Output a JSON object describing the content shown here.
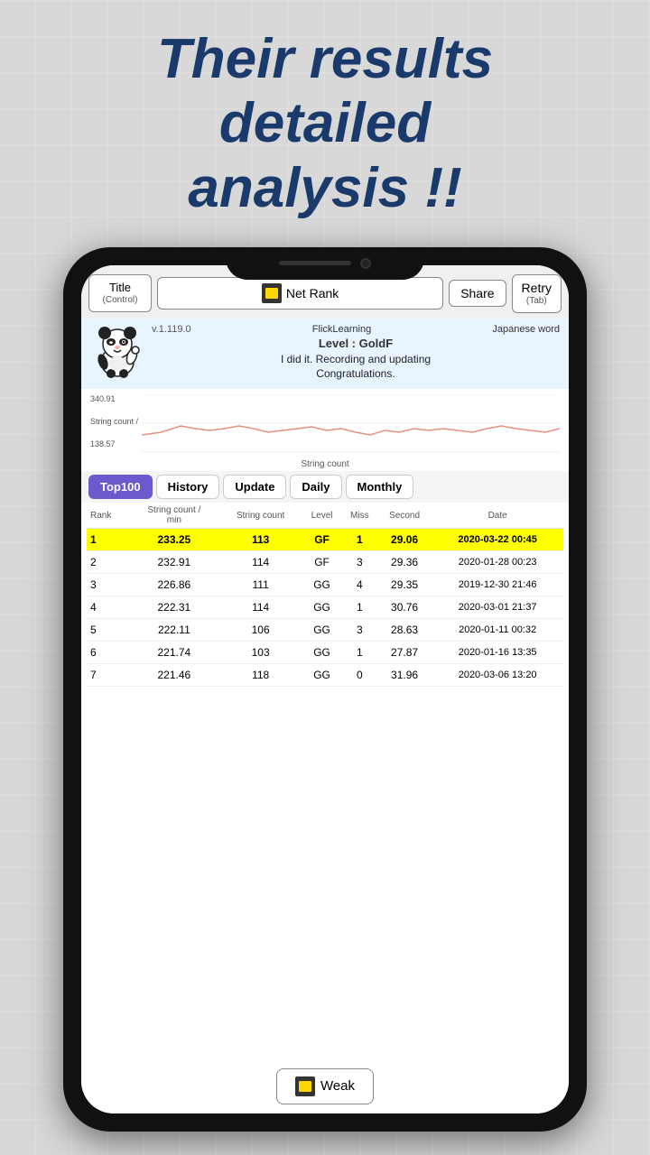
{
  "headline": {
    "line1": "Their results",
    "line2": "detailed",
    "line3": "analysis !!"
  },
  "toolbar": {
    "title_label": "Title",
    "title_sub": "(Control)",
    "netrank_label": "Net Rank",
    "share_label": "Share",
    "retry_label": "Retry",
    "retry_sub": "(Tab)"
  },
  "info": {
    "version": "v.1.119.0",
    "app_name": "FlickLearning",
    "subject": "Japanese word",
    "level": "Level : GoldF",
    "message": "I did it. Recording and updating\nCongratulations."
  },
  "chart": {
    "y_top": "340.91",
    "y_label": "String count /",
    "y_bot": "138.57",
    "x_label": "String count"
  },
  "tabs": [
    {
      "label": "Top100",
      "active": true
    },
    {
      "label": "History",
      "active": false
    },
    {
      "label": "Update",
      "active": false
    },
    {
      "label": "Daily",
      "active": false
    },
    {
      "label": "Monthly",
      "active": false
    }
  ],
  "table": {
    "headers": [
      "Rank",
      "String count /\nmin",
      "String count",
      "Level",
      "Miss",
      "Second",
      "Date"
    ],
    "rows": [
      {
        "rank": "1",
        "str_per_min": "233.25",
        "str_count": "113",
        "level": "GF",
        "miss": "1",
        "second": "29.06",
        "date": "2020-03-22 00:45",
        "highlight": true
      },
      {
        "rank": "2",
        "str_per_min": "232.91",
        "str_count": "114",
        "level": "GF",
        "miss": "3",
        "second": "29.36",
        "date": "2020-01-28 00:23",
        "highlight": false
      },
      {
        "rank": "3",
        "str_per_min": "226.86",
        "str_count": "111",
        "level": "GG",
        "miss": "4",
        "second": "29.35",
        "date": "2019-12-30 21:46",
        "highlight": false
      },
      {
        "rank": "4",
        "str_per_min": "222.31",
        "str_count": "114",
        "level": "GG",
        "miss": "1",
        "second": "30.76",
        "date": "2020-03-01 21:37",
        "highlight": false
      },
      {
        "rank": "5",
        "str_per_min": "222.11",
        "str_count": "106",
        "level": "GG",
        "miss": "3",
        "second": "28.63",
        "date": "2020-01-11 00:32",
        "highlight": false
      },
      {
        "rank": "6",
        "str_per_min": "221.74",
        "str_count": "103",
        "level": "GG",
        "miss": "1",
        "second": "27.87",
        "date": "2020-01-16 13:35",
        "highlight": false
      },
      {
        "rank": "7",
        "str_per_min": "221.46",
        "str_count": "118",
        "level": "GG",
        "miss": "0",
        "second": "31.96",
        "date": "2020-03-06 13:20",
        "highlight": false
      }
    ]
  },
  "weak_button": {
    "label": "Weak"
  }
}
